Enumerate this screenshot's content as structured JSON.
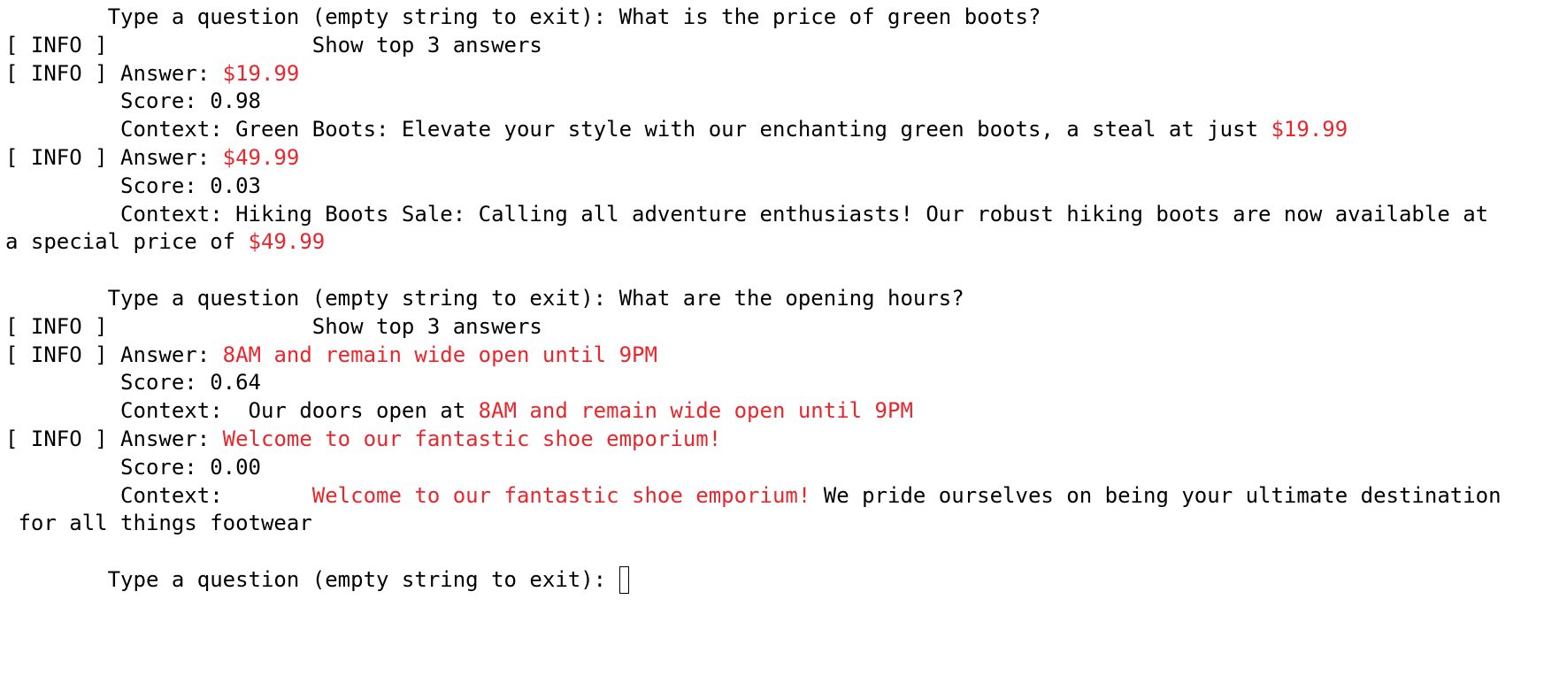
{
  "colors": {
    "text": "#000000",
    "highlight": "#e8262b",
    "background": "#ffffff"
  },
  "lines": [
    [
      {
        "t": "        Type a question (empty string to exit): What is the price of green boots?"
      }
    ],
    [
      {
        "t": "[ INFO ]                Show top 3 answers"
      }
    ],
    [
      {
        "t": "[ INFO ] Answer: "
      },
      {
        "t": "$19.99",
        "hl": true
      }
    ],
    [
      {
        "t": "         Score: 0.98"
      }
    ],
    [
      {
        "t": "         Context: Green Boots: Elevate your style with our enchanting green boots, a steal at just "
      },
      {
        "t": "$19.99",
        "hl": true
      }
    ],
    [
      {
        "t": "[ INFO ] Answer: "
      },
      {
        "t": "$49.99",
        "hl": true
      }
    ],
    [
      {
        "t": "         Score: 0.03"
      }
    ],
    [
      {
        "t": "         Context: Hiking Boots Sale: Calling all adventure enthusiasts! Our robust hiking boots are now available at"
      }
    ],
    [
      {
        "t": "a special price of "
      },
      {
        "t": "$49.99",
        "hl": true
      }
    ],
    [],
    [
      {
        "t": "        Type a question (empty string to exit): What are the opening hours?"
      }
    ],
    [
      {
        "t": "[ INFO ]                Show top 3 answers"
      }
    ],
    [
      {
        "t": "[ INFO ] Answer: "
      },
      {
        "t": "8AM and remain wide open until 9PM",
        "hl": true
      }
    ],
    [
      {
        "t": "         Score: 0.64"
      }
    ],
    [
      {
        "t": "         Context:  Our doors open at "
      },
      {
        "t": "8AM and remain wide open until 9PM",
        "hl": true
      }
    ],
    [
      {
        "t": "[ INFO ] Answer: "
      },
      {
        "t": "Welcome to our fantastic shoe emporium!",
        "hl": true
      }
    ],
    [
      {
        "t": "         Score: 0.00"
      }
    ],
    [
      {
        "t": "         Context:       "
      },
      {
        "t": "Welcome to our fantastic shoe emporium!",
        "hl": true
      },
      {
        "t": " We pride ourselves on being your ultimate destination"
      }
    ],
    [
      {
        "t": " for all things footwear"
      }
    ],
    [],
    [
      {
        "t": "        Type a question (empty string to exit): "
      },
      {
        "cursor": true
      }
    ]
  ]
}
